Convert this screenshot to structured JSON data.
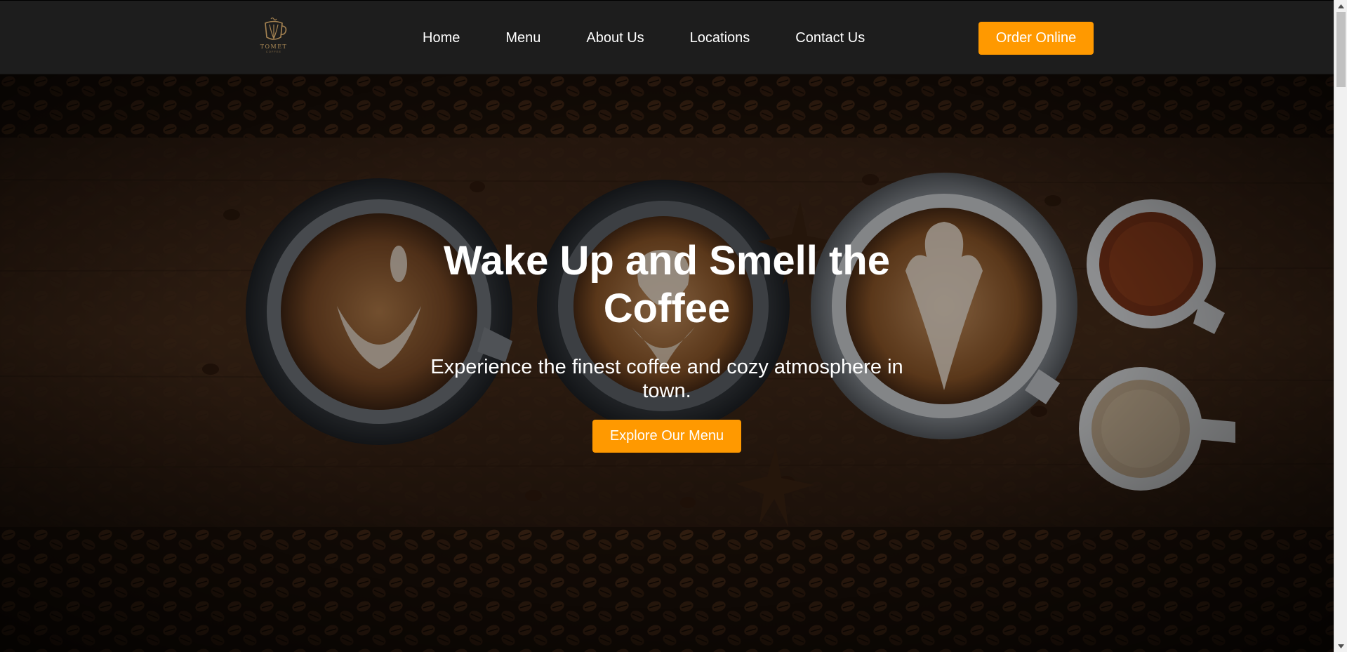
{
  "brand": {
    "name": "TOMET",
    "tagline": "COFFEE"
  },
  "nav": {
    "items": [
      {
        "label": "Home"
      },
      {
        "label": "Menu"
      },
      {
        "label": "About Us"
      },
      {
        "label": "Locations"
      },
      {
        "label": "Contact Us"
      }
    ],
    "cta_label": "Order Online"
  },
  "hero": {
    "title": "Wake Up and Smell the Coffee",
    "subtitle": "Experience the finest coffee and cozy atmosphere in town.",
    "button_label": "Explore Our Menu"
  },
  "colors": {
    "accent": "#ff9900",
    "header_bg": "#1d1d1d",
    "text": "#ffffff"
  },
  "icons": {
    "logo": "coffee-cup-logo-icon",
    "scroll_up": "triangle-up-icon",
    "scroll_down": "triangle-down-icon"
  }
}
